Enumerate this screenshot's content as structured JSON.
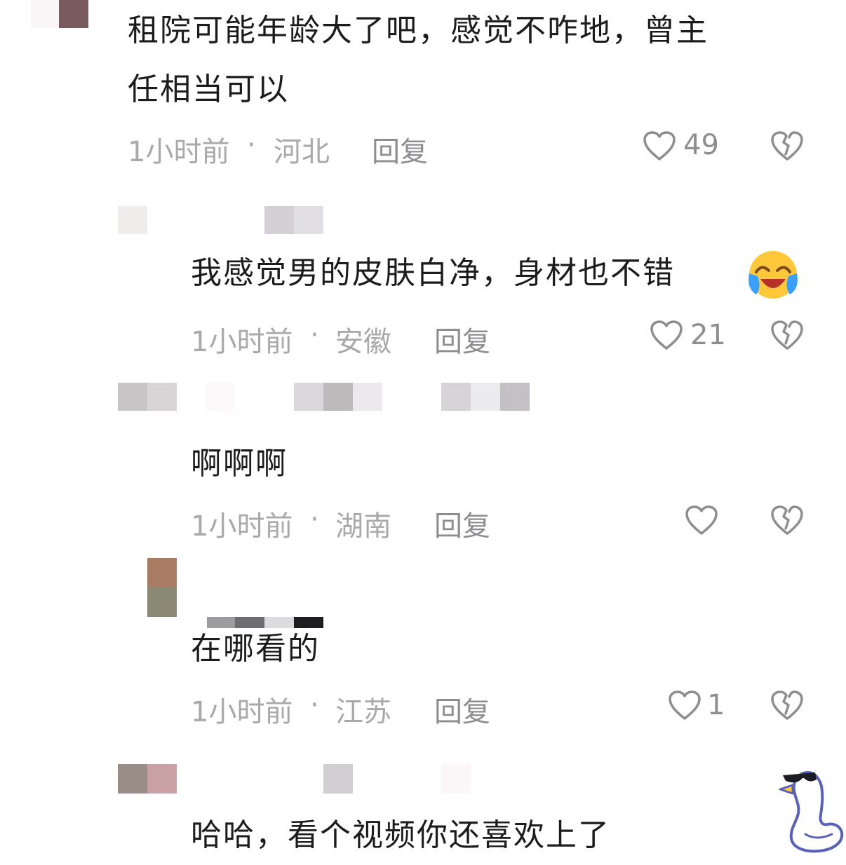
{
  "comments": [
    {
      "text_lines": [
        "租院可能年龄大了吧，感觉不咋地，曾主",
        "任相当可以"
      ],
      "time": "1小时前",
      "location": "河北",
      "reply_label": "回复",
      "likes": "49"
    },
    {
      "text_lines": [
        "我感觉男的皮肤白净，身材也不错"
      ],
      "emoji": "laughing-crying-face",
      "time": "1小时前",
      "location": "安徽",
      "reply_label": "回复",
      "likes": "21"
    },
    {
      "text_lines": [
        "啊啊啊"
      ],
      "time": "1小时前",
      "location": "湖南",
      "reply_label": "回复",
      "likes": ""
    },
    {
      "text_lines": [
        "在哪看的"
      ],
      "time": "1小时前",
      "location": "江苏",
      "reply_label": "回复",
      "likes": "1"
    },
    {
      "text_lines": [
        "哈哈，看个视频你还喜欢上了"
      ]
    }
  ],
  "separator": "·",
  "icons": {
    "like": "heart-outline-icon",
    "dislike": "broken-heart-icon",
    "watermark": "duck-with-sunglasses"
  },
  "colors": {
    "text": "#1c1c1c",
    "meta": "#a9a9ab",
    "icon": "#8e8e90"
  }
}
